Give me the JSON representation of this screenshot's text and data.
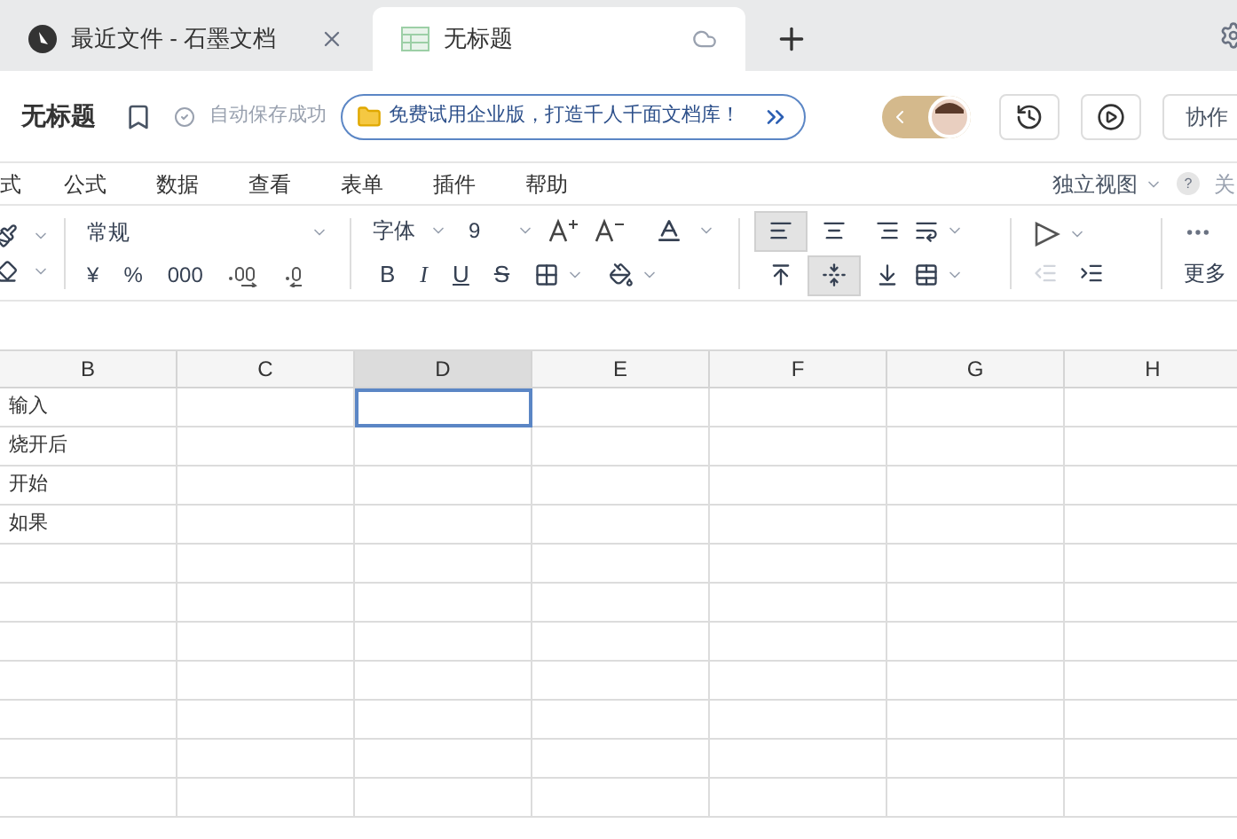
{
  "tabs": [
    {
      "title": "最近文件 - 石墨文档",
      "kind": "home",
      "selected": false
    },
    {
      "title": "无标题",
      "kind": "sheet",
      "selected": true
    }
  ],
  "header": {
    "doc_title": "无标题",
    "save_status": "自动保存成功",
    "banner": "免费试用企业版，打造千人千面文档库！",
    "collab_button": "协作"
  },
  "menu": {
    "items": [
      "式",
      "公式",
      "数据",
      "查看",
      "表单",
      "插件",
      "帮助"
    ],
    "view": "独立视图",
    "help": "?",
    "close": "关"
  },
  "toolbar": {
    "number_format": "常规",
    "currency": "¥",
    "percent": "%",
    "thousands": "000",
    "font": "字体",
    "font_size": "9",
    "bold": "B",
    "italic": "I",
    "underline": "U",
    "strike": "S",
    "more": "更多",
    "h_align": [
      {
        "kind": "left",
        "selected": true
      },
      {
        "kind": "center",
        "selected": false
      },
      {
        "kind": "right",
        "selected": false
      }
    ],
    "v_align": [
      {
        "kind": "top",
        "selected": false
      },
      {
        "kind": "middle",
        "selected": true
      },
      {
        "kind": "bottom",
        "selected": false
      }
    ]
  },
  "sheet": {
    "columns": [
      {
        "label": "B",
        "selected": false
      },
      {
        "label": "C",
        "selected": false
      },
      {
        "label": "D",
        "selected": true
      },
      {
        "label": "E",
        "selected": false
      },
      {
        "label": "F",
        "selected": false
      },
      {
        "label": "G",
        "selected": false
      },
      {
        "label": "H",
        "selected": false
      }
    ],
    "rows": [
      {
        "cells": [
          {
            "text": "输入",
            "selected": false
          },
          {
            "selected": false
          },
          {
            "selected": true
          },
          {
            "selected": false
          },
          {
            "selected": false
          },
          {
            "selected": false
          },
          {
            "selected": false
          }
        ]
      },
      {
        "cells": [
          {
            "text": "烧开后",
            "selected": false
          },
          {
            "selected": false
          },
          {
            "selected": false
          },
          {
            "selected": false
          },
          {
            "selected": false
          },
          {
            "selected": false
          },
          {
            "selected": false
          }
        ]
      },
      {
        "cells": [
          {
            "text": "开始",
            "selected": false
          },
          {
            "selected": false
          },
          {
            "selected": false
          },
          {
            "selected": false
          },
          {
            "selected": false
          },
          {
            "selected": false
          },
          {
            "selected": false
          }
        ]
      },
      {
        "cells": [
          {
            "text": "如果",
            "selected": false
          },
          {
            "selected": false
          },
          {
            "selected": false
          },
          {
            "selected": false
          },
          {
            "selected": false
          },
          {
            "selected": false
          },
          {
            "selected": false
          }
        ]
      }
    ]
  }
}
